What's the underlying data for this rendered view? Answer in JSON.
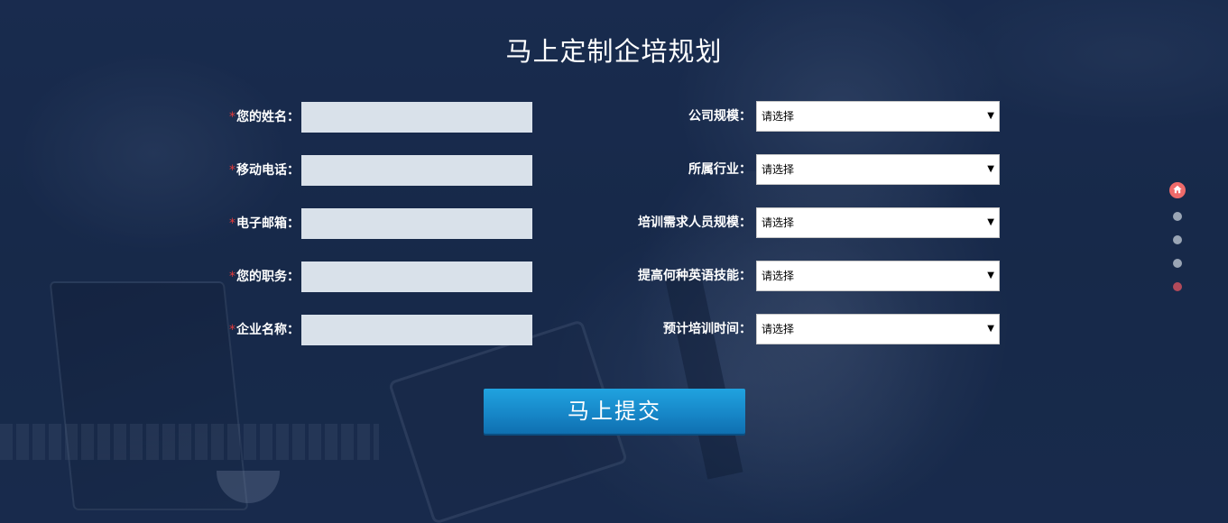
{
  "page_title": "马上定制企培规划",
  "required_mark": "*",
  "left_fields": [
    {
      "label": "您的姓名：",
      "value": "",
      "placeholder": ""
    },
    {
      "label": "移动电话：",
      "value": "",
      "placeholder": ""
    },
    {
      "label": "电子邮箱：",
      "value": "",
      "placeholder": ""
    },
    {
      "label": "您的职务：",
      "value": "",
      "placeholder": ""
    },
    {
      "label": "企业名称：",
      "value": "",
      "placeholder": ""
    }
  ],
  "right_fields": [
    {
      "label": "公司规模：",
      "selected": "请选择"
    },
    {
      "label": "所属行业：",
      "selected": "请选择"
    },
    {
      "label": "培训需求人员规模：",
      "selected": "请选择"
    },
    {
      "label": "提高何种英语技能：",
      "selected": "请选择"
    },
    {
      "label": "预计培训时间：",
      "selected": "请选择"
    }
  ],
  "submit_label": "马上提交",
  "dropdown_arrow": "▼",
  "pager": {
    "active_index": 0,
    "items": [
      "home-icon",
      "dot",
      "dot",
      "dot",
      "dot"
    ],
    "colors": {
      "active": "#ee6a6a",
      "inactive": "#9aa5b5",
      "last": "#b24a5a"
    }
  },
  "colors": {
    "accent_button": "#1787c8",
    "required_star": "#e23b3b",
    "input_bg": "#d9e1ea"
  }
}
